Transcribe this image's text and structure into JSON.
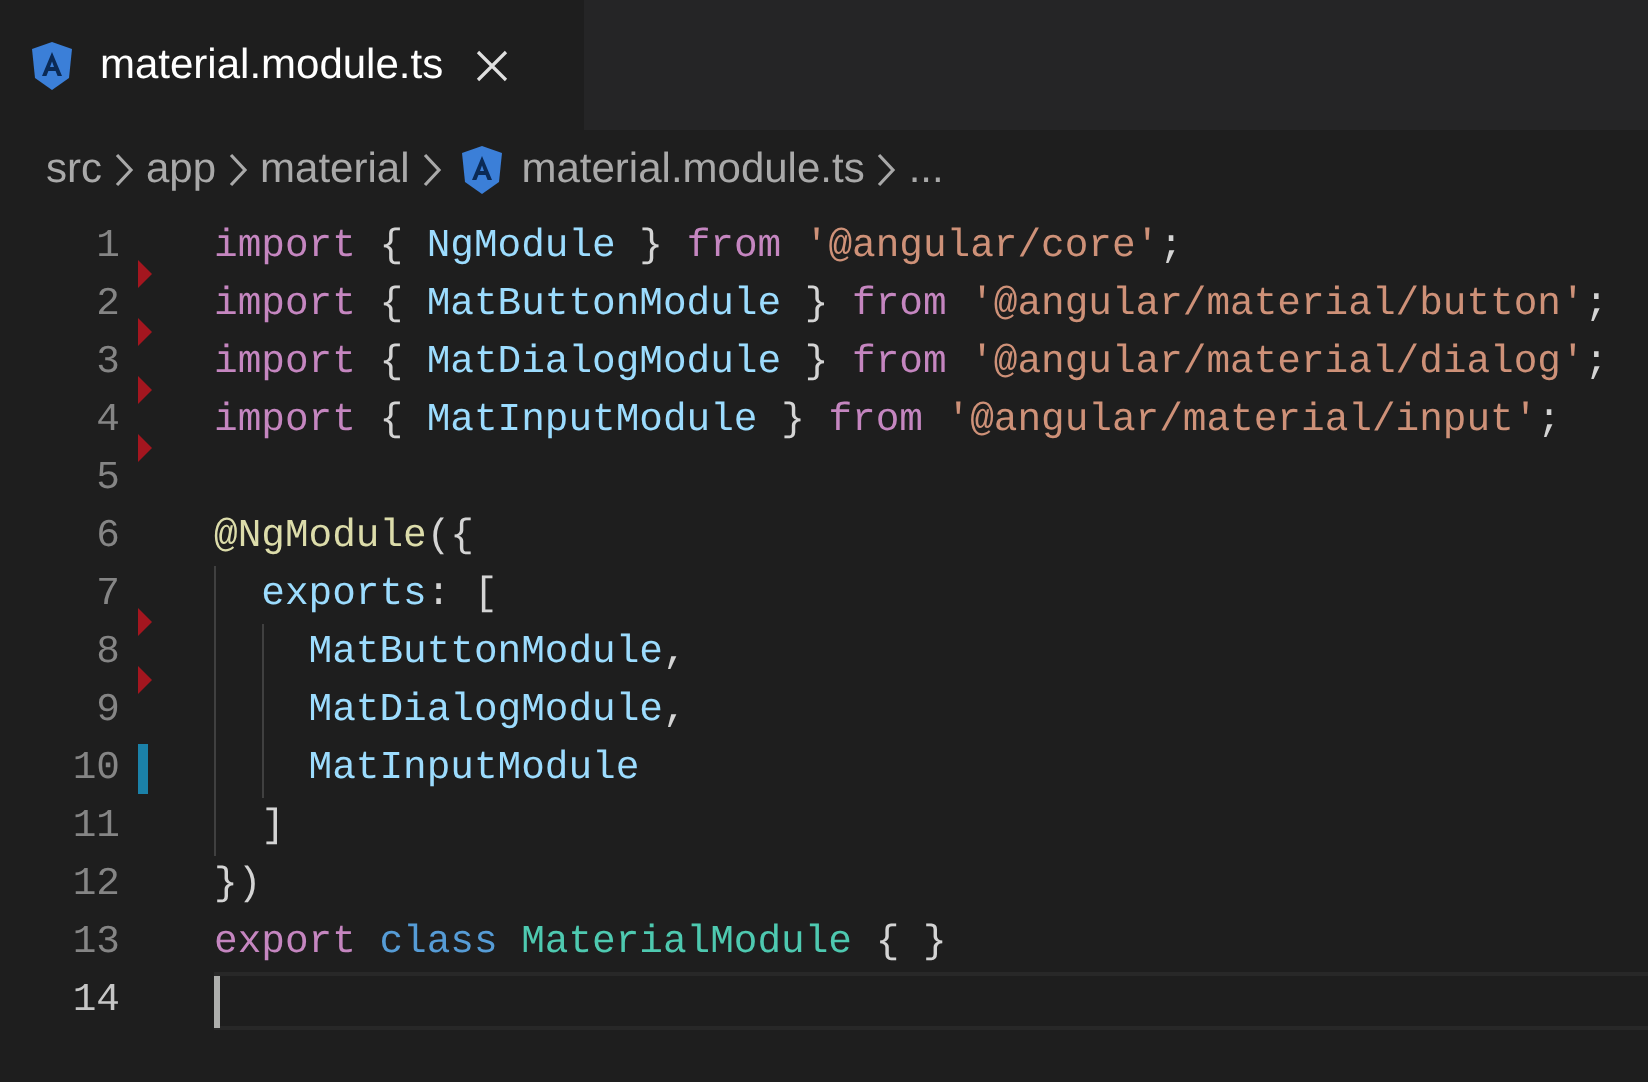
{
  "tabs": [
    {
      "label": "material.module.ts",
      "selected": true
    }
  ],
  "breadcrumbs": [
    {
      "kind": "folder",
      "label": "src"
    },
    {
      "kind": "folder",
      "label": "app"
    },
    {
      "kind": "folder",
      "label": "material"
    },
    {
      "kind": "file",
      "label": "material.module.ts"
    },
    {
      "kind": "folder",
      "label": "..."
    }
  ],
  "lines": [
    {
      "number": "1",
      "deleted_below": true,
      "modified": false,
      "current": false,
      "tokens": [
        {
          "kind": "keyword",
          "text": "import"
        },
        {
          "kind": "punct",
          "text": " { "
        },
        {
          "kind": "ident",
          "text": "NgModule"
        },
        {
          "kind": "punct",
          "text": " } "
        },
        {
          "kind": "keyword",
          "text": "from"
        },
        {
          "kind": "string",
          "text": " '@angular/core'"
        },
        {
          "kind": "punct",
          "text": ";"
        }
      ]
    },
    {
      "number": "2",
      "deleted_below": true,
      "modified": false,
      "current": false,
      "tokens": [
        {
          "kind": "keyword",
          "text": "import"
        },
        {
          "kind": "punct",
          "text": " { "
        },
        {
          "kind": "ident",
          "text": "MatButtonModule"
        },
        {
          "kind": "punct",
          "text": " } "
        },
        {
          "kind": "keyword",
          "text": "from"
        },
        {
          "kind": "string",
          "text": " '@angular/material/button'"
        },
        {
          "kind": "punct",
          "text": ";"
        }
      ]
    },
    {
      "number": "3",
      "deleted_below": true,
      "modified": false,
      "current": false,
      "tokens": [
        {
          "kind": "keyword",
          "text": "import"
        },
        {
          "kind": "punct",
          "text": " { "
        },
        {
          "kind": "ident",
          "text": "MatDialogModule"
        },
        {
          "kind": "punct",
          "text": " } "
        },
        {
          "kind": "keyword",
          "text": "from"
        },
        {
          "kind": "string",
          "text": " '@angular/material/dialog'"
        },
        {
          "kind": "punct",
          "text": ";"
        }
      ]
    },
    {
      "number": "4",
      "deleted_below": true,
      "modified": false,
      "current": false,
      "tokens": [
        {
          "kind": "keyword",
          "text": "import"
        },
        {
          "kind": "punct",
          "text": " { "
        },
        {
          "kind": "ident",
          "text": "MatInputModule"
        },
        {
          "kind": "punct",
          "text": " } "
        },
        {
          "kind": "keyword",
          "text": "from"
        },
        {
          "kind": "string",
          "text": " '@angular/material/input'"
        },
        {
          "kind": "punct",
          "text": ";"
        }
      ]
    },
    {
      "number": "5",
      "deleted_below": false,
      "modified": false,
      "current": false
    },
    {
      "number": "6",
      "deleted_below": false,
      "modified": false,
      "current": false,
      "tokens": [
        {
          "kind": "decorator",
          "text": "@NgModule"
        },
        {
          "kind": "punct",
          "text": "({"
        }
      ],
      "children": [
        {
          "number": "7",
          "deleted_below": true,
          "modified": false,
          "current": false,
          "tokens": [
            {
              "kind": "ident",
              "text": "exports"
            },
            {
              "kind": "punct",
              "text": ": ["
            }
          ],
          "children": [
            {
              "number": "8",
              "deleted_below": true,
              "modified": false,
              "current": false,
              "tokens": [
                {
                  "kind": "ident",
                  "text": "MatButtonModule"
                },
                {
                  "kind": "punct",
                  "text": ","
                }
              ]
            },
            {
              "number": "9",
              "deleted_below": false,
              "modified": false,
              "current": false,
              "tokens": [
                {
                  "kind": "ident",
                  "text": "MatDialogModule"
                },
                {
                  "kind": "punct",
                  "text": ","
                }
              ]
            },
            {
              "number": "10",
              "deleted_below": false,
              "modified": true,
              "current": false,
              "tokens": [
                {
                  "kind": "ident",
                  "text": "MatInputModule"
                }
              ]
            }
          ]
        },
        {
          "number": "11",
          "deleted_below": false,
          "modified": false,
          "current": false,
          "tokens": [
            {
              "kind": "punct",
              "text": "]"
            }
          ]
        }
      ]
    },
    {
      "number": "12",
      "deleted_below": false,
      "modified": false,
      "current": false,
      "tokens": [
        {
          "kind": "punct",
          "text": "})"
        }
      ]
    },
    {
      "number": "13",
      "deleted_below": false,
      "modified": false,
      "current": false,
      "tokens": [
        {
          "kind": "keyword",
          "text": "export"
        },
        {
          "kind": "storage",
          "text": " class"
        },
        {
          "kind": "type",
          "text": " MaterialModule"
        },
        {
          "kind": "punct",
          "text": " { }"
        }
      ]
    },
    {
      "number": "14",
      "deleted_below": false,
      "modified": false,
      "current": true
    }
  ]
}
